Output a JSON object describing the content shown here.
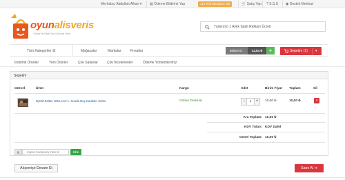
{
  "topbar": {
    "user": "Merhaba, Abdullah Alkan ▾",
    "payment_notify": "Ödeme Bildirimi Yap",
    "badge": "114 Yeni Mesajınız Var",
    "order": "Satış Yap",
    "faq": "S.S.S",
    "help": "Destek Merkezi"
  },
  "logo": {
    "part1": "oyun",
    "part2": "alisveris",
    "tagline": "Türkiye'nin Dijital Oyun Alışveriş Sitesi"
  },
  "search": {
    "value": "Turlenmo 1 Aylık Sabit Reklam Ücreti"
  },
  "nav": {
    "categories": "Tüm Kategoriler ☰",
    "stores": "Mağazalar",
    "brands": "Markalar",
    "opportunities": "Fırsatlar",
    "wallet_label": "Bakiyeniz :",
    "wallet_value": "12,84 ₺",
    "wallet_add": "+",
    "cart": "Sepetim (1)",
    "cart_arrow": "▾"
  },
  "subnav": [
    "İndirimli Ürünler",
    "Yeni Ürünler",
    "Çok Satanlar",
    "Çok İncelenenler",
    "Ödeme Yöntemlerimiz"
  ],
  "cart": {
    "title": "Sepetim",
    "headers": {
      "image": "Görsel",
      "product": "Ürün",
      "shipping": "Kargo",
      "qty": "Adet",
      "unit_price": "Birim Fiyat",
      "total": "Toplam",
      "delete": "Sil"
    },
    "row": {
      "name": "DyMZ Zaltan 105 Level 1. Sırada Boş Karakter Satılır",
      "shipping": "Online Teslimat",
      "qty": "1",
      "minus": "−",
      "plus": "+",
      "unit_price": "10,00 ₺",
      "total": "10,00 ₺",
      "delete": "×"
    },
    "summary": {
      "subtotal_label": "Ara Toplam:",
      "subtotal_value": "10,00 ₺",
      "tax_label": "KDV Tutarı:",
      "tax_value": "KDV Dahil",
      "total_label": "Genel Toplam:",
      "total_value": "10,00 ₺"
    },
    "coupon": {
      "placeholder": "Kupon Kodunuzu Yazınız",
      "apply": "Ekle"
    }
  },
  "actions": {
    "continue": "Alışverişe Devam Et",
    "buy": "Satın Al ➜"
  }
}
